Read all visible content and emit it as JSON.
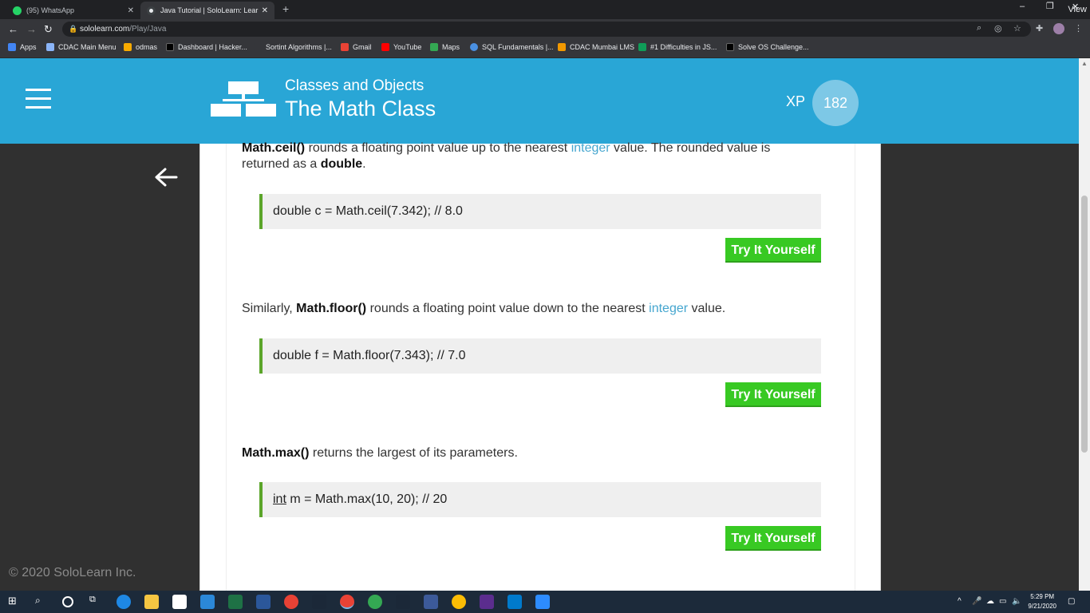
{
  "browser": {
    "tabs": [
      {
        "title": "(95) WhatsApp",
        "color": "#25d366"
      },
      {
        "title": "Java Tutorial | SoloLearn: Learn t…",
        "color": "#e8eaed"
      }
    ],
    "view_label": "View",
    "url_domain": "sololearn.com",
    "url_path": "/Play/Java",
    "bookmarks": [
      {
        "label": "Apps",
        "color": "#4285f4"
      },
      {
        "label": "CDAC Main Menu",
        "color": "#8ab4f8"
      },
      {
        "label": "odmas",
        "color": "#f9ab00"
      },
      {
        "label": "Dashboard | Hacker...",
        "color": "#1a1a1a"
      },
      {
        "label": "Sortint Algorithms |...",
        "color": "#35363a"
      },
      {
        "label": "Gmail",
        "color": "#ea4335"
      },
      {
        "label": "YouTube",
        "color": "#ff0000"
      },
      {
        "label": "Maps",
        "color": "#34a853"
      },
      {
        "label": "SQL Fundamentals |...",
        "color": "#4a90e2"
      },
      {
        "label": "CDAC Mumbai LMS",
        "color": "#f29900"
      },
      {
        "label": "#1 Difficulties in JS...",
        "color": "#0f9d58"
      },
      {
        "label": "Solve OS Challenge...",
        "color": "#1a1a1a"
      }
    ]
  },
  "header": {
    "chapter": "Classes and Objects",
    "lesson": "The Math Class",
    "xp_label": "XP",
    "xp_value": "182"
  },
  "content": {
    "p1": {
      "term": "Math.ceil()",
      "text1": " rounds a floating point value up to the nearest ",
      "link": "integer",
      "text2": " value. The rounded value is returned as a ",
      "term2": "double",
      "text3": "."
    },
    "code1": "double c = Math.ceil(7.342);  // 8.0",
    "p2": {
      "text0": "Similarly, ",
      "term": "Math.floor()",
      "text1": " rounds a floating point value down to the nearest ",
      "link": "integer",
      "text2": " value."
    },
    "code2": "double f = Math.floor(7.343);  // 7.0",
    "p3": {
      "term": "Math.max()",
      "text1": " returns the largest of its parameters."
    },
    "code3_kw": "int",
    "code3_rest": " m = Math.max(10, 20);  // 20",
    "try_label": "Try It Yourself",
    "copyright": "© 2020 SoloLearn Inc."
  },
  "taskbar": {
    "time": "5:29 PM",
    "date": "9/21/2020"
  }
}
